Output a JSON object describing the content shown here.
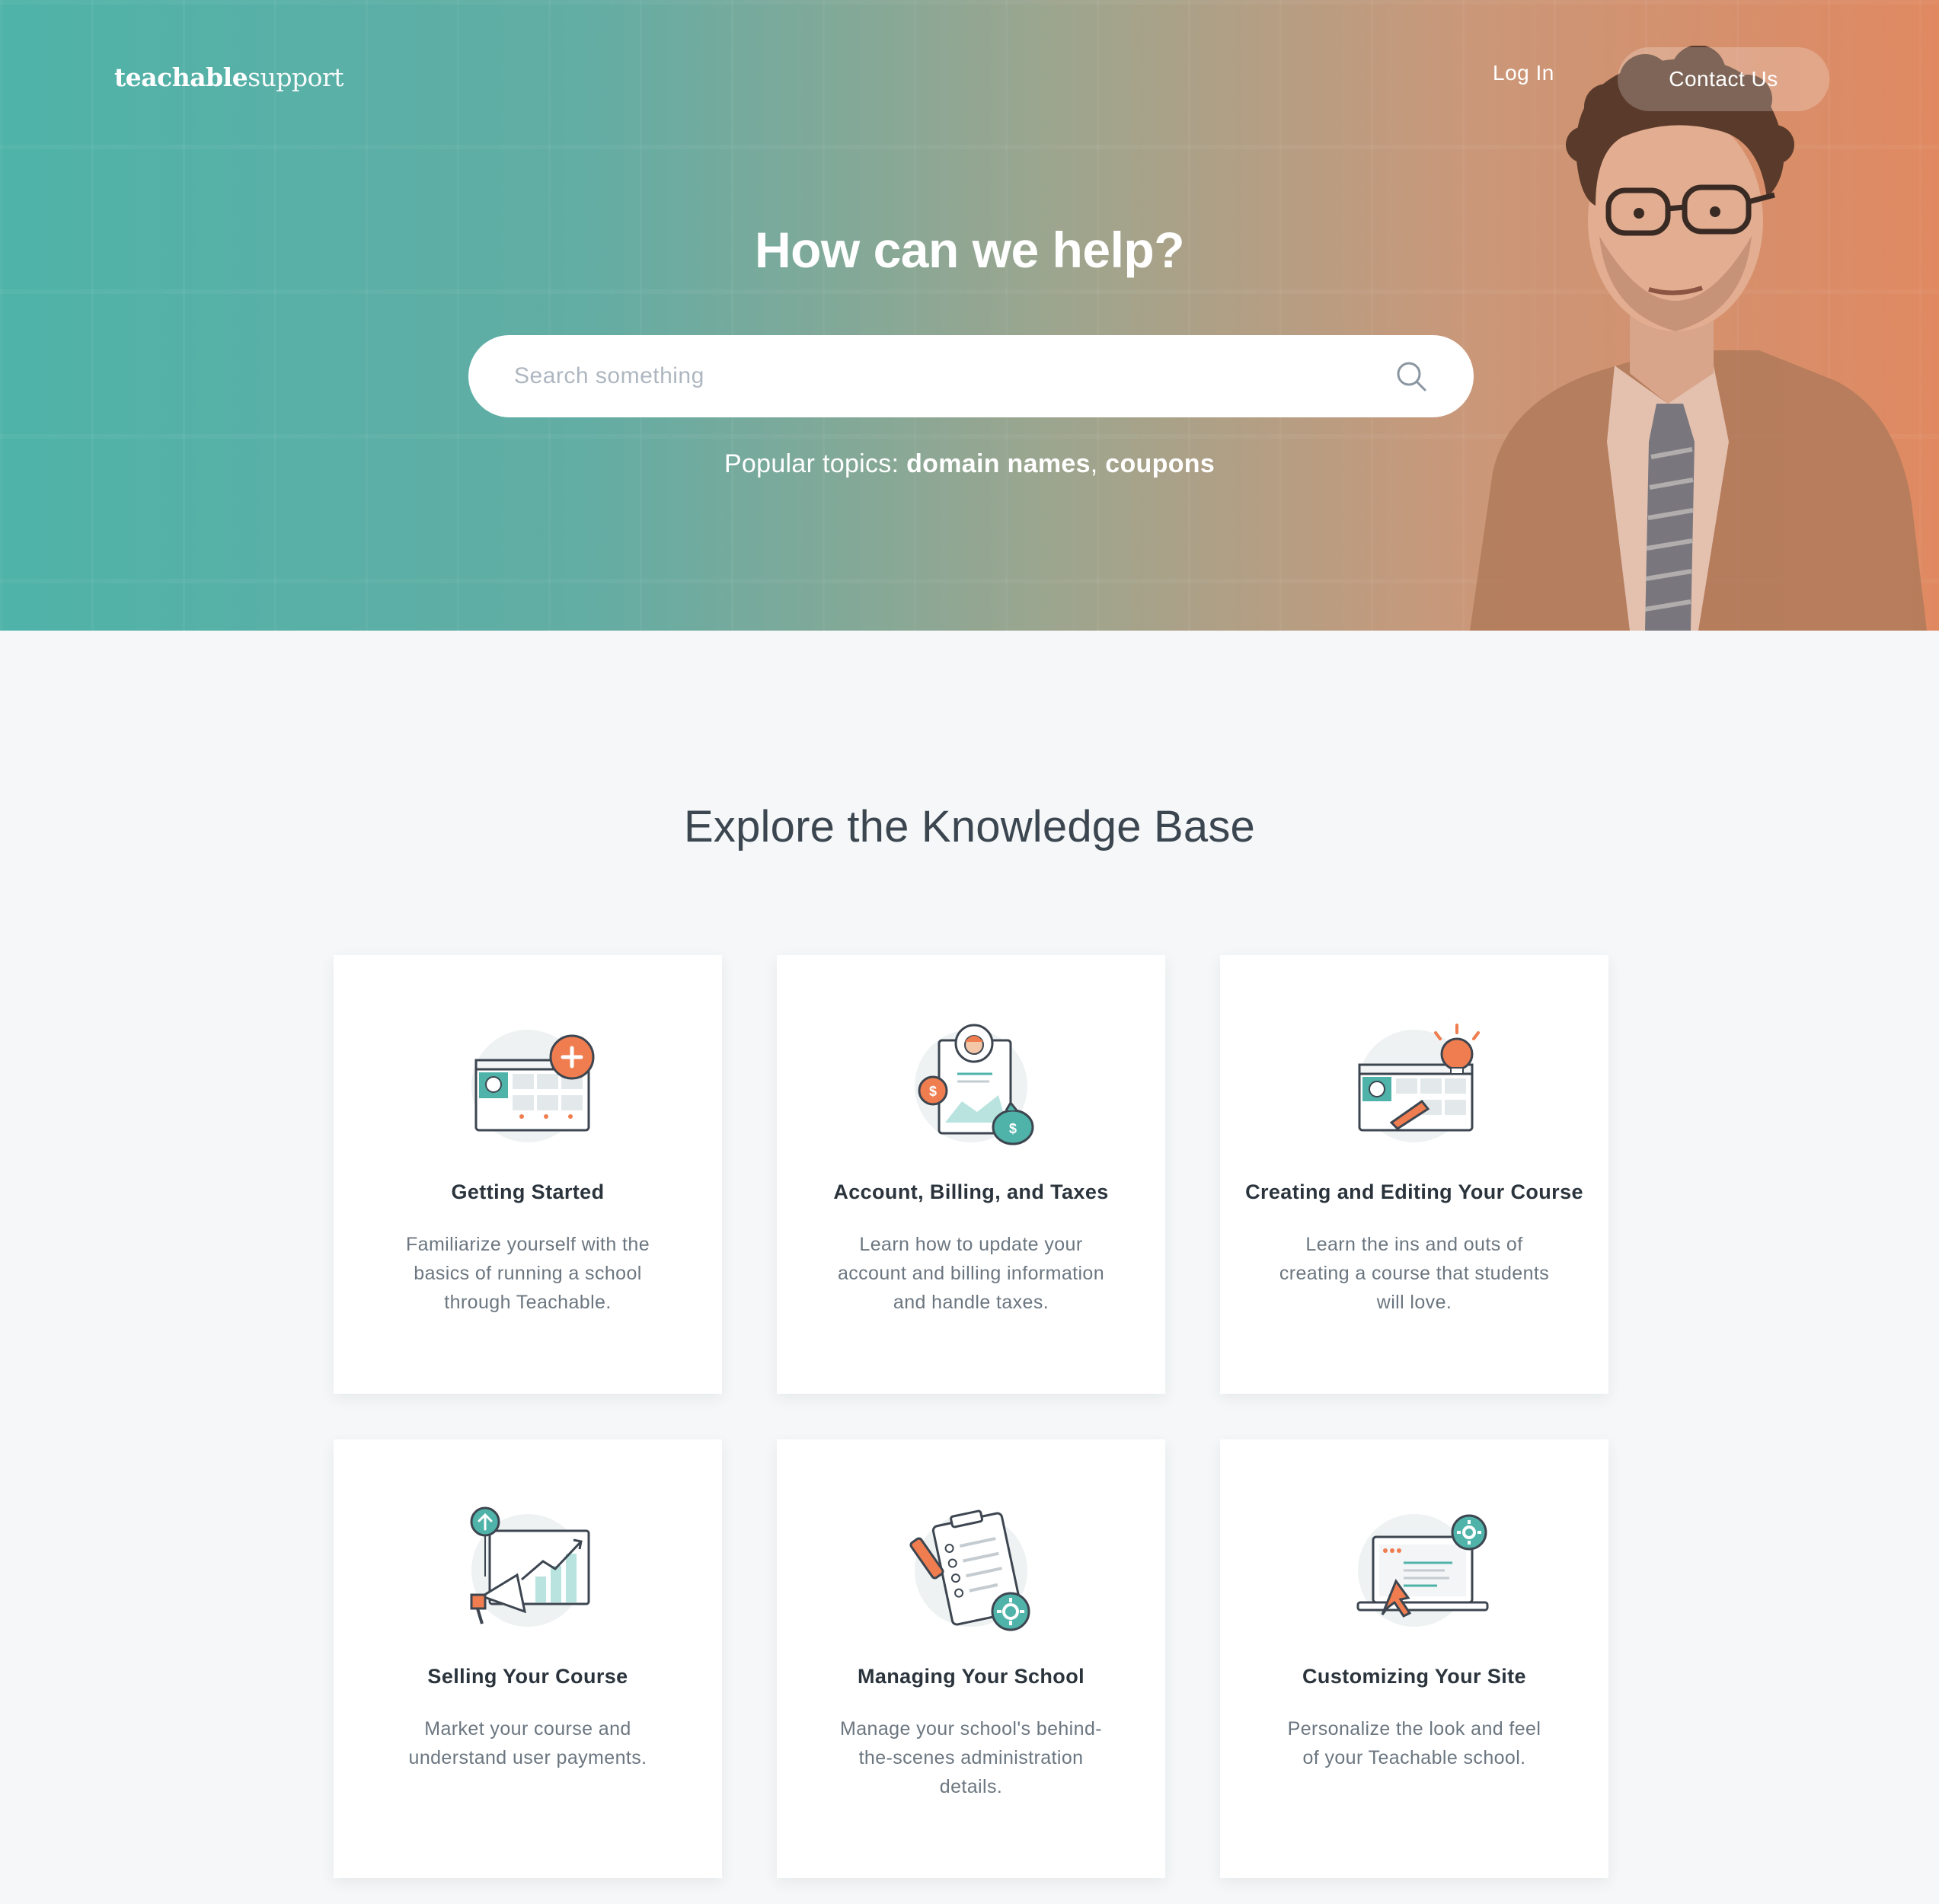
{
  "header": {
    "logo_bold": "teachable",
    "logo_light": "support",
    "login_label": "Log In",
    "contact_label": "Contact Us"
  },
  "hero": {
    "title": "How can we help?",
    "search_placeholder": "Search something",
    "popular_prefix": "Popular topics: ",
    "popular_topics": [
      "domain names",
      "coupons"
    ],
    "popular_separator": ", "
  },
  "knowledge_base": {
    "title": "Explore the Knowledge Base",
    "cards": [
      {
        "title": "Getting Started",
        "description": "Familiarize yourself with the basics of running a school through Teachable.",
        "icon": "course-add-icon"
      },
      {
        "title": "Account, Billing, and Taxes",
        "description": "Learn how to update your account and billing information and handle taxes.",
        "icon": "billing-icon"
      },
      {
        "title": "Creating and Editing Your Course",
        "description": "Learn the ins and outs of creating a course that students will love.",
        "icon": "course-edit-icon"
      },
      {
        "title": "Selling Your Course",
        "description": "Market your course and understand user payments.",
        "icon": "megaphone-chart-icon"
      },
      {
        "title": "Managing Your School",
        "description": "Manage your school's behind-the-scenes administration details.",
        "icon": "clipboard-gear-icon"
      },
      {
        "title": "Customizing Your Site",
        "description": "Personalize the look and feel of your Teachable school.",
        "icon": "laptop-customize-icon"
      }
    ]
  },
  "colors": {
    "teal": "#4fb3a9",
    "orange": "#f07d4f",
    "page_bg": "#f5f7f8"
  }
}
